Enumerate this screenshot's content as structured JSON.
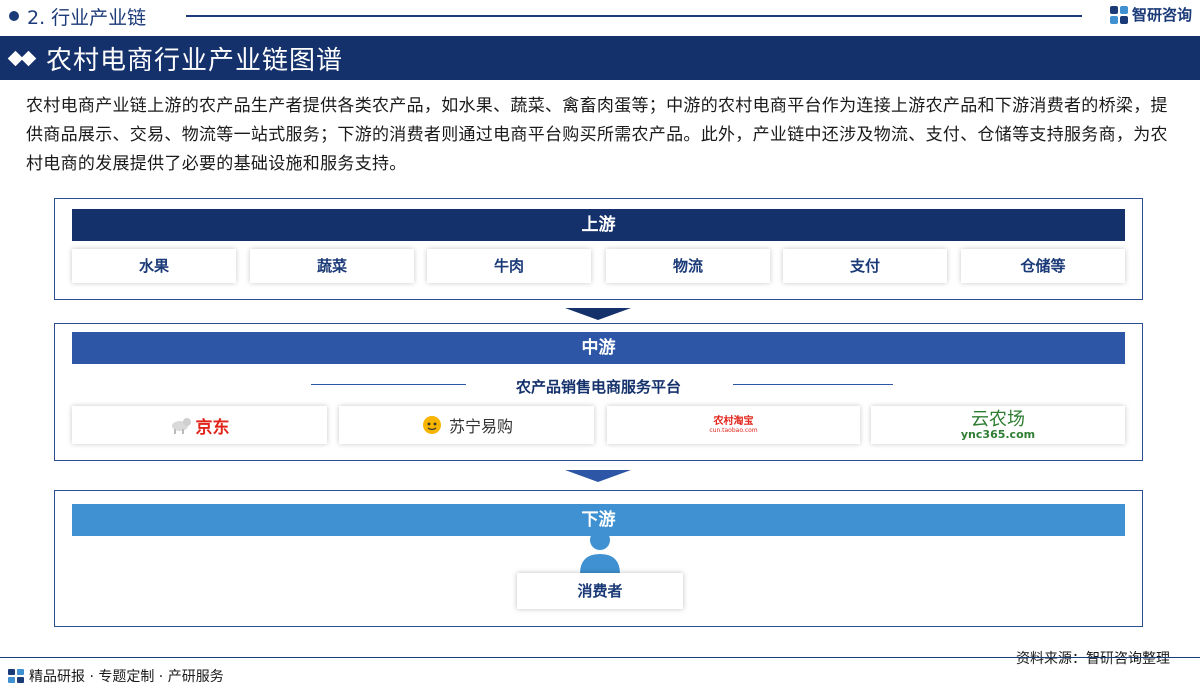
{
  "header": {
    "section_label": "2. 行业产业链",
    "logo_text": "智研咨询"
  },
  "banner": {
    "title": "农村电商行业产业链图谱"
  },
  "intro": "农村电商产业链上游的农产品生产者提供各类农产品，如水果、蔬菜、禽畜肉蛋等；中游的农村电商平台作为连接上游农产品和下游消费者的桥梁，提供商品展示、交易、物流等一站式服务；下游的消费者则通过电商平台购买所需农产品。此外，产业链中还涉及物流、支付、仓储等支持服务商，为农村电商的发展提供了必要的基础设施和服务支持。",
  "upstream": {
    "title": "上游",
    "items": [
      "水果",
      "蔬菜",
      "牛肉",
      "物流",
      "支付",
      "仓储等"
    ]
  },
  "midstream": {
    "title": "中游",
    "platform_title": "农产品销售电商服务平台",
    "brands": [
      {
        "name": "京东",
        "color": "#e1251b"
      },
      {
        "name": "苏宁易购",
        "color": "#333333"
      },
      {
        "name": "农村淘宝",
        "sub": "cun.taobao.com",
        "color": "#e1251b"
      },
      {
        "name": "云农场",
        "sub": "ync365.com",
        "color": "#2e7d32"
      }
    ]
  },
  "downstream": {
    "title": "下游",
    "consumer_label": "消费者"
  },
  "footer": {
    "source": "资料来源：智研咨询整理",
    "tagline": "精品研报 · 专题定制 · 产研服务"
  },
  "colors": {
    "navy": "#15316b",
    "mid_blue": "#2d56a7",
    "light_blue": "#3f91d1"
  }
}
